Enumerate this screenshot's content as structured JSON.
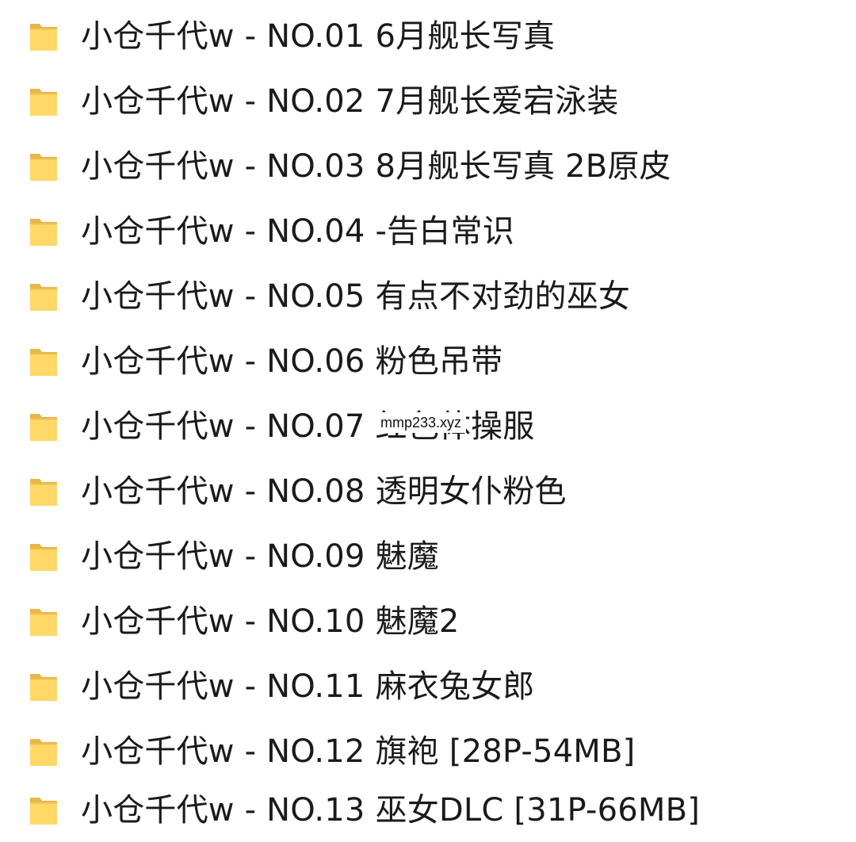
{
  "folders": [
    {
      "name": "小仓千代w - NO.01 6月舰长写真"
    },
    {
      "name": "小仓千代w - NO.02 7月舰长爱宕泳装"
    },
    {
      "name": "小仓千代w - NO.03 8月舰长写真 2B原皮"
    },
    {
      "name": "小仓千代w - NO.04 -告白常识"
    },
    {
      "name": "小仓千代w - NO.05 有点不对劲的巫女"
    },
    {
      "name": "小仓千代w - NO.06 粉色吊带"
    },
    {
      "name": "小仓千代w - NO.07 红色体操服"
    },
    {
      "name": "小仓千代w - NO.08 透明女仆粉色"
    },
    {
      "name": "小仓千代w - NO.09 魅魔"
    },
    {
      "name": "小仓千代w - NO.10 魅魔2"
    },
    {
      "name": "小仓千代w - NO.11 麻衣兔女郎"
    },
    {
      "name": "小仓千代w - NO.12 旗袍 [28P-54MB]"
    },
    {
      "name": "小仓千代w - NO.13 巫女DLC [31P-66MB]"
    }
  ],
  "watermark": "mmp233.xyz",
  "icon": "folder-icon",
  "colors": {
    "folder_back": "#E8B74A",
    "folder_front": "#FFD867",
    "text": "#1a1a1a"
  }
}
